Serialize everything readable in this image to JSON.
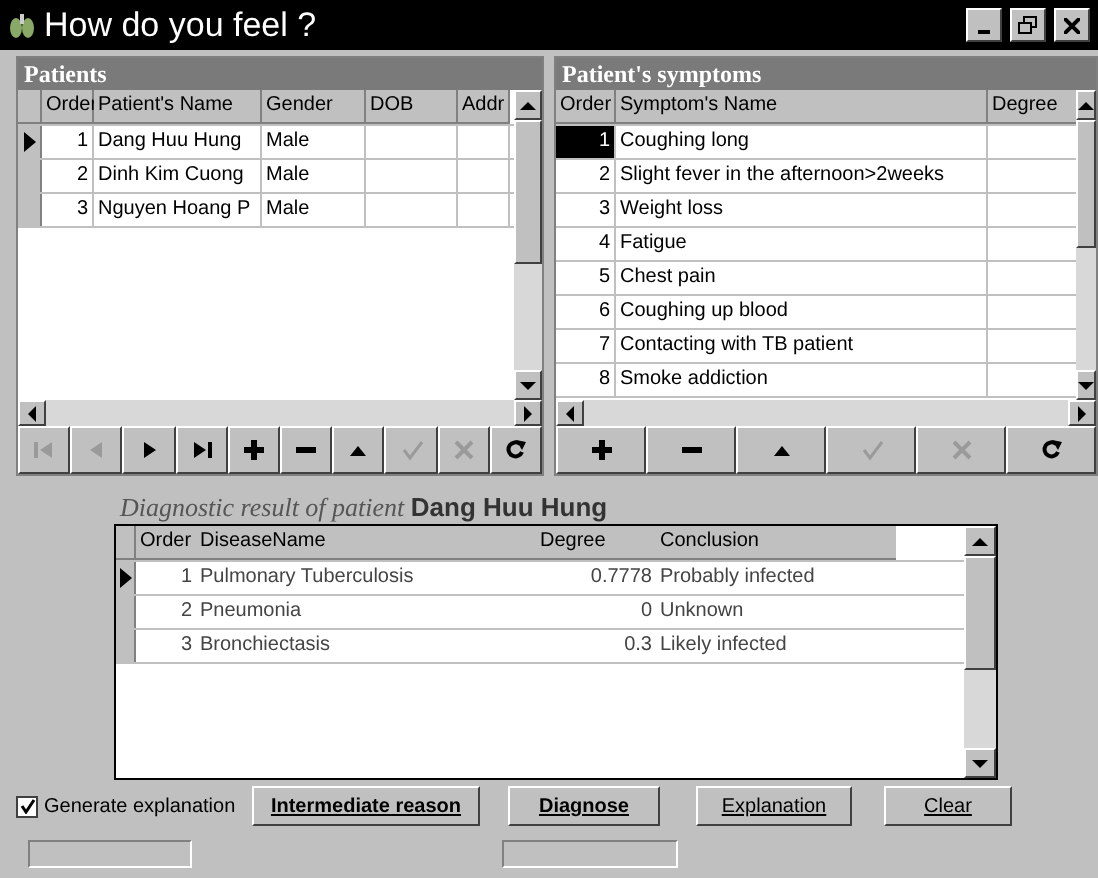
{
  "window": {
    "title": "How do you feel ?"
  },
  "patients": {
    "title": "Patients",
    "columns": [
      "Order",
      "Patient's Name",
      "Gender",
      "DOB",
      "Addr"
    ],
    "rows": [
      {
        "cells": [
          "1",
          "Dang Huu Hung",
          "Male",
          "",
          ""
        ],
        "selected": true
      },
      {
        "cells": [
          "2",
          "Dinh Kim Cuong",
          "Male",
          "",
          ""
        ],
        "selected": false
      },
      {
        "cells": [
          "3",
          "Nguyen Hoang P",
          "Male",
          "",
          ""
        ],
        "selected": false
      }
    ],
    "nav": [
      {
        "kind": "first",
        "disabled": true
      },
      {
        "kind": "prev",
        "disabled": true
      },
      {
        "kind": "next",
        "disabled": false
      },
      {
        "kind": "last",
        "disabled": false
      },
      {
        "kind": "add",
        "disabled": false
      },
      {
        "kind": "delete",
        "disabled": false
      },
      {
        "kind": "edit",
        "disabled": false
      },
      {
        "kind": "post",
        "disabled": true
      },
      {
        "kind": "cancel",
        "disabled": true
      },
      {
        "kind": "refresh",
        "disabled": false
      }
    ]
  },
  "symptoms": {
    "title": "Patient's symptoms",
    "columns": [
      "Order",
      "Symptom's Name",
      "Degree"
    ],
    "rows": [
      {
        "cells": [
          "1",
          "Coughing long",
          ""
        ],
        "selected": true
      },
      {
        "cells": [
          "2",
          "Slight fever in the afternoon>2weeks",
          ""
        ],
        "selected": false
      },
      {
        "cells": [
          "3",
          "Weight loss",
          ""
        ],
        "selected": false
      },
      {
        "cells": [
          "4",
          "Fatigue",
          ""
        ],
        "selected": false
      },
      {
        "cells": [
          "5",
          "Chest pain",
          ""
        ],
        "selected": false
      },
      {
        "cells": [
          "6",
          "Coughing up blood",
          ""
        ],
        "selected": false
      },
      {
        "cells": [
          "7",
          "Contacting with TB patient",
          ""
        ],
        "selected": false
      },
      {
        "cells": [
          "8",
          "Smoke addiction",
          ""
        ],
        "selected": false
      }
    ],
    "nav": [
      {
        "kind": "add",
        "disabled": false
      },
      {
        "kind": "delete",
        "disabled": false
      },
      {
        "kind": "edit",
        "disabled": false
      },
      {
        "kind": "post",
        "disabled": true
      },
      {
        "kind": "cancel",
        "disabled": true
      },
      {
        "kind": "refresh",
        "disabled": false
      }
    ]
  },
  "diagnosis": {
    "caption": "Diagnostic result of patient",
    "patient": "Dang Huu Hung",
    "columns": [
      "Order",
      "DiseaseName",
      "Degree",
      "Conclusion"
    ],
    "rows": [
      {
        "cells": [
          "1",
          "Pulmonary Tuberculosis",
          "0.7778",
          "Probably infected"
        ],
        "selected": true
      },
      {
        "cells": [
          "2",
          "Pneumonia",
          "0",
          "Unknown"
        ],
        "selected": false
      },
      {
        "cells": [
          "3",
          "Bronchiectasis",
          "0.3",
          "Likely infected"
        ],
        "selected": false
      }
    ]
  },
  "options": {
    "label": "Generate explanation",
    "checked": true
  },
  "buttons": [
    "Intermediate reason",
    "Diagnose",
    "Explanation",
    "Clear"
  ]
}
